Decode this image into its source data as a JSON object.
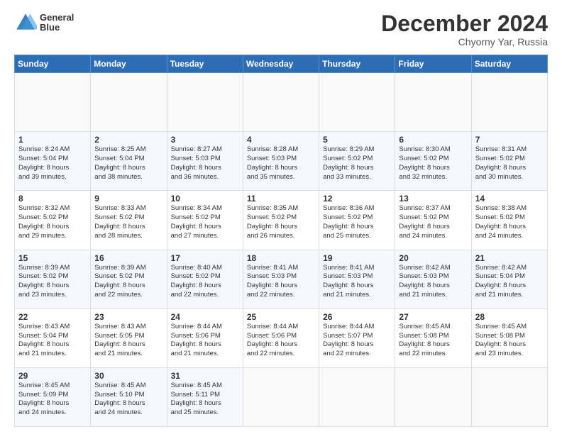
{
  "header": {
    "logo_line1": "General",
    "logo_line2": "Blue",
    "title": "December 2024",
    "subtitle": "Chyorny Yar, Russia"
  },
  "calendar": {
    "weekdays": [
      "Sunday",
      "Monday",
      "Tuesday",
      "Wednesday",
      "Thursday",
      "Friday",
      "Saturday"
    ],
    "weeks": [
      [
        {
          "day": "",
          "info": ""
        },
        {
          "day": "",
          "info": ""
        },
        {
          "day": "",
          "info": ""
        },
        {
          "day": "",
          "info": ""
        },
        {
          "day": "",
          "info": ""
        },
        {
          "day": "",
          "info": ""
        },
        {
          "day": "",
          "info": ""
        }
      ],
      [
        {
          "day": "1",
          "info": "Sunrise: 8:24 AM\nSunset: 5:04 PM\nDaylight: 8 hours\nand 39 minutes."
        },
        {
          "day": "2",
          "info": "Sunrise: 8:25 AM\nSunset: 5:04 PM\nDaylight: 8 hours\nand 38 minutes."
        },
        {
          "day": "3",
          "info": "Sunrise: 8:27 AM\nSunset: 5:03 PM\nDaylight: 8 hours\nand 36 minutes."
        },
        {
          "day": "4",
          "info": "Sunrise: 8:28 AM\nSunset: 5:03 PM\nDaylight: 8 hours\nand 35 minutes."
        },
        {
          "day": "5",
          "info": "Sunrise: 8:29 AM\nSunset: 5:02 PM\nDaylight: 8 hours\nand 33 minutes."
        },
        {
          "day": "6",
          "info": "Sunrise: 8:30 AM\nSunset: 5:02 PM\nDaylight: 8 hours\nand 32 minutes."
        },
        {
          "day": "7",
          "info": "Sunrise: 8:31 AM\nSunset: 5:02 PM\nDaylight: 8 hours\nand 30 minutes."
        }
      ],
      [
        {
          "day": "8",
          "info": "Sunrise: 8:32 AM\nSunset: 5:02 PM\nDaylight: 8 hours\nand 29 minutes."
        },
        {
          "day": "9",
          "info": "Sunrise: 8:33 AM\nSunset: 5:02 PM\nDaylight: 8 hours\nand 28 minutes."
        },
        {
          "day": "10",
          "info": "Sunrise: 8:34 AM\nSunset: 5:02 PM\nDaylight: 8 hours\nand 27 minutes."
        },
        {
          "day": "11",
          "info": "Sunrise: 8:35 AM\nSunset: 5:02 PM\nDaylight: 8 hours\nand 26 minutes."
        },
        {
          "day": "12",
          "info": "Sunrise: 8:36 AM\nSunset: 5:02 PM\nDaylight: 8 hours\nand 25 minutes."
        },
        {
          "day": "13",
          "info": "Sunrise: 8:37 AM\nSunset: 5:02 PM\nDaylight: 8 hours\nand 24 minutes."
        },
        {
          "day": "14",
          "info": "Sunrise: 8:38 AM\nSunset: 5:02 PM\nDaylight: 8 hours\nand 24 minutes."
        }
      ],
      [
        {
          "day": "15",
          "info": "Sunrise: 8:39 AM\nSunset: 5:02 PM\nDaylight: 8 hours\nand 23 minutes."
        },
        {
          "day": "16",
          "info": "Sunrise: 8:39 AM\nSunset: 5:02 PM\nDaylight: 8 hours\nand 22 minutes."
        },
        {
          "day": "17",
          "info": "Sunrise: 8:40 AM\nSunset: 5:02 PM\nDaylight: 8 hours\nand 22 minutes."
        },
        {
          "day": "18",
          "info": "Sunrise: 8:41 AM\nSunset: 5:03 PM\nDaylight: 8 hours\nand 22 minutes."
        },
        {
          "day": "19",
          "info": "Sunrise: 8:41 AM\nSunset: 5:03 PM\nDaylight: 8 hours\nand 21 minutes."
        },
        {
          "day": "20",
          "info": "Sunrise: 8:42 AM\nSunset: 5:03 PM\nDaylight: 8 hours\nand 21 minutes."
        },
        {
          "day": "21",
          "info": "Sunrise: 8:42 AM\nSunset: 5:04 PM\nDaylight: 8 hours\nand 21 minutes."
        }
      ],
      [
        {
          "day": "22",
          "info": "Sunrise: 8:43 AM\nSunset: 5:04 PM\nDaylight: 8 hours\nand 21 minutes."
        },
        {
          "day": "23",
          "info": "Sunrise: 8:43 AM\nSunset: 5:05 PM\nDaylight: 8 hours\nand 21 minutes."
        },
        {
          "day": "24",
          "info": "Sunrise: 8:44 AM\nSunset: 5:06 PM\nDaylight: 8 hours\nand 21 minutes."
        },
        {
          "day": "25",
          "info": "Sunrise: 8:44 AM\nSunset: 5:06 PM\nDaylight: 8 hours\nand 22 minutes."
        },
        {
          "day": "26",
          "info": "Sunrise: 8:44 AM\nSunset: 5:07 PM\nDaylight: 8 hours\nand 22 minutes."
        },
        {
          "day": "27",
          "info": "Sunrise: 8:45 AM\nSunset: 5:08 PM\nDaylight: 8 hours\nand 22 minutes."
        },
        {
          "day": "28",
          "info": "Sunrise: 8:45 AM\nSunset: 5:08 PM\nDaylight: 8 hours\nand 23 minutes."
        }
      ],
      [
        {
          "day": "29",
          "info": "Sunrise: 8:45 AM\nSunset: 5:09 PM\nDaylight: 8 hours\nand 24 minutes."
        },
        {
          "day": "30",
          "info": "Sunrise: 8:45 AM\nSunset: 5:10 PM\nDaylight: 8 hours\nand 24 minutes."
        },
        {
          "day": "31",
          "info": "Sunrise: 8:45 AM\nSunset: 5:11 PM\nDaylight: 8 hours\nand 25 minutes."
        },
        {
          "day": "",
          "info": ""
        },
        {
          "day": "",
          "info": ""
        },
        {
          "day": "",
          "info": ""
        },
        {
          "day": "",
          "info": ""
        }
      ]
    ]
  }
}
